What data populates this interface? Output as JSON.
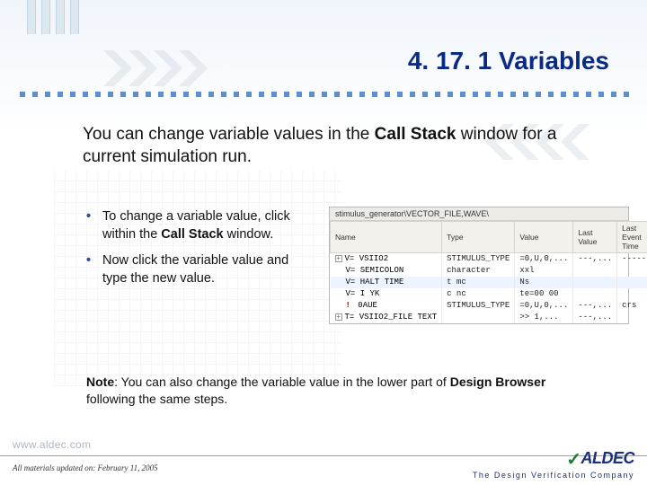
{
  "title": "4. 17. 1 Variables",
  "intro": {
    "prefix": "You can change variable values in the ",
    "bold1": "Call Stack",
    "suffix": " window for a current simulation run."
  },
  "bullets": [
    {
      "pre": "To change a variable value, click within the ",
      "bold": "Call Stack",
      "post": " window."
    },
    {
      "pre": "Now click the variable value and type the new value.",
      "bold": "",
      "post": ""
    }
  ],
  "note": {
    "lead": "Note",
    "pre": ": You can also change the variable value in the lower part of ",
    "bold": "Design Browser ",
    "post": "following the same steps."
  },
  "footer": {
    "url": "www.aldec.com",
    "date": "All materials updated on: February 11, 2005",
    "brand": "ALDEC",
    "tagline": "The Design Verification Company"
  },
  "screenshot": {
    "caption": "stimulus_generator\\VECTOR_FILE,WAVE\\",
    "columns": [
      "Name",
      "Type",
      "Value",
      "Last Value",
      "Last Event Time"
    ],
    "rows": [
      {
        "icon": "+",
        "name": "V= VSIIO2",
        "type": "STIMULUS_TYPE",
        "value": "=0,U,0,...",
        "last": "---,...",
        "evt": "------"
      },
      {
        "icon": " ",
        "name": "V= SEMICOLON",
        "type": "character",
        "value": "xxl",
        "last": "",
        "evt": ""
      },
      {
        "icon": " ",
        "name": "V= HALT TIME",
        "type": "t mc",
        "value": "Ns",
        "last": "",
        "evt": "",
        "hl": true
      },
      {
        "icon": " ",
        "name": "V= I YK",
        "type": "c nc",
        "value": "te=00 00",
        "last": "",
        "evt": ""
      },
      {
        "icon": " ",
        "warn": "!",
        "name": "  0AUE",
        "type": "STIMULUS_TYPE",
        "value": "=0,U,0,...",
        "last": "---,...",
        "evt": "    crs"
      },
      {
        "icon": "+",
        "name": "T= VSIIO2_FILE TEXT",
        "type": "",
        "value": ">> 1,...",
        "last": "---,...",
        "evt": ""
      }
    ]
  }
}
